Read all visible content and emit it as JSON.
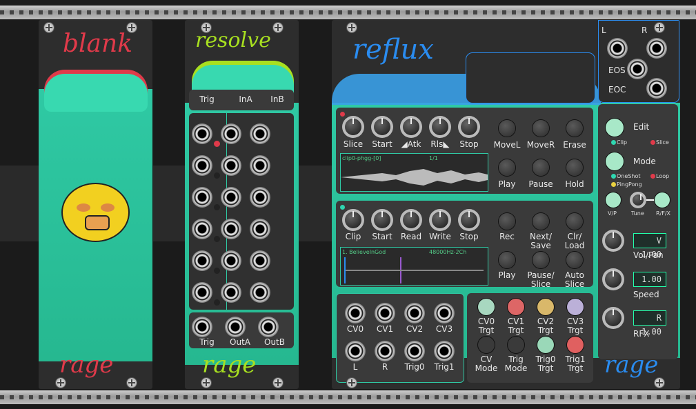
{
  "modules": {
    "blank": {
      "title": "blank",
      "footer": "rage"
    },
    "resolve": {
      "title": "resolve",
      "header": [
        "Trig",
        "InA",
        "InB"
      ],
      "footer_labels": [
        "Trig",
        "OutA",
        "OutB"
      ],
      "footer": "rage"
    },
    "reflux": {
      "title": "reflux",
      "footer": "rage",
      "output": {
        "left": "L",
        "right": "R",
        "eos": "EOS",
        "eoc": "EOC"
      },
      "play_section": {
        "knobs": [
          "Slice",
          "Start",
          "◢Atk",
          "Rls◣",
          "Stop"
        ],
        "buttons": [
          "MoveL",
          "MoveR",
          "Erase",
          "Play",
          "Pause",
          "Hold"
        ],
        "wave_name": "clip0-phgg-[0]",
        "wave_info": "1/1"
      },
      "rec_section": {
        "knobs": [
          "Clip",
          "Start",
          "Read",
          "Write",
          "Stop"
        ],
        "buttons": [
          "Rec",
          "Next/\nSave",
          "Clr/\nLoad",
          "Play",
          "Pause/\nSlice",
          "Auto\nSlice"
        ],
        "wave_name": "1. BelieveInGod",
        "wave_info": "48000Hz-2Ch"
      },
      "cv_section": {
        "row1": [
          "CV0",
          "CV1",
          "CV2",
          "CV3"
        ],
        "row2": [
          "L",
          "R",
          "Trig0",
          "Trig1"
        ]
      },
      "target_section": {
        "row1": [
          "CV0\nTrgt",
          "CV1\nTrgt",
          "CV2\nTrgt",
          "CV3\nTrgt"
        ],
        "row2": [
          "CV\nMode",
          "Trig\nMode",
          "Trig0\nTrgt",
          "Trig1\nTrgt"
        ],
        "row1_colors": [
          "#a8d8c0",
          "#d66",
          "#d9b86a",
          "#bbb0d8"
        ],
        "row2_colors": [
          "#3a3a3a",
          "#3a3a3a",
          "#9ad8b8",
          "#e06060"
        ]
      },
      "side": {
        "edit": "Edit",
        "edit_opts": [
          "Clip",
          "Slice"
        ],
        "mode": "Mode",
        "mode_opts": [
          "OneShot",
          "Loop",
          "PingPong"
        ],
        "tune_labels": [
          "V/P",
          "Tune",
          "R/F/X"
        ],
        "vol_display": "V 1.00",
        "vol_label": "Vol/Pan",
        "speed_display": "1.00",
        "speed_label": "Speed",
        "rfx_display": "R 1.00",
        "rfx_label": "RFX"
      }
    }
  },
  "colors": {
    "teal": "#2ec4a0",
    "red": "#e03a4a",
    "lime": "#a8e020",
    "blue": "#2a8cf0",
    "panel": "#2d2d2d"
  }
}
